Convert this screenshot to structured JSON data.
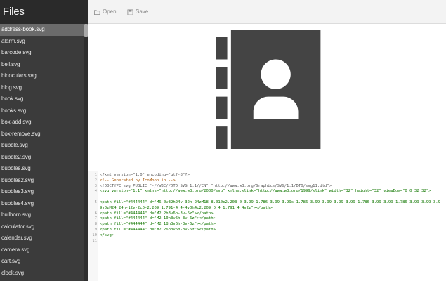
{
  "sidebar": {
    "title": "Files",
    "files": [
      "address-book.svg",
      "alarm.svg",
      "barcode.svg",
      "bell.svg",
      "binoculars.svg",
      "blog.svg",
      "book.svg",
      "books.svg",
      "box-add.svg",
      "box-remove.svg",
      "bubble.svg",
      "bubble2.svg",
      "bubbles.svg",
      "bubbles2.svg",
      "bubbles3.svg",
      "bubbles4.svg",
      "bullhorn.svg",
      "calculator.svg",
      "calendar.svg",
      "camera.svg",
      "cart.svg",
      "clock.svg"
    ],
    "active_index": 0
  },
  "toolbar": {
    "open_label": "Open",
    "save_label": "Save"
  },
  "editor": {
    "lines": [
      {
        "n": "1",
        "text": "<?xml version=\"1.0\" encoding=\"utf-8\"?>"
      },
      {
        "n": "2",
        "text": "<!-- Generated by IcoMoon.io -->"
      },
      {
        "n": "3",
        "text": "<!DOCTYPE svg PUBLIC \"-//W3C//DTD SVG 1.1//EN\" \"http://www.w3.org/Graphics/SVG/1.1/DTD/svg11.dtd\">"
      },
      {
        "n": "4",
        "text": "<svg version=\"1.1\" xmlns=\"http://www.w3.org/2000/svg\" xmlns:xlink=\"http://www.w3.org/1999/xlink\" width=\"32\" height=\"32\" viewBox=\"0 0 32 32\">"
      },
      {
        "n": "5",
        "text": "<path fill=\"#444444\" d=\"M6 0v32h24v-32h-24zM18 8.010c2.203 0 3.99 1.786 3.99 3.99s-1.786 3.99-3.99 3.99-3.99-1.786-3.99-3.99 1.786-3.99 3.99-3.99v0zM24 24h-12v-2c0-2.209 1.791-4 4-4v0h4c2.209 0 4 1.791 4 4v2z\"></path>"
      },
      {
        "n": "6",
        "text": "<path fill=\"#444444\" d=\"M2 2h3v6h-3v-6z\"></path>"
      },
      {
        "n": "7",
        "text": "<path fill=\"#444444\" d=\"M2 10h3v6h-3v-6z\"></path>"
      },
      {
        "n": "8",
        "text": "<path fill=\"#444444\" d=\"M2 18h3v6h-3v-6z\"></path>"
      },
      {
        "n": "9",
        "text": "<path fill=\"#444444\" d=\"M2 26h3v6h-3v-6z\"></path>"
      },
      {
        "n": "10",
        "text": "</svg>"
      },
      {
        "n": "11",
        "text": ""
      }
    ]
  },
  "preview": {
    "icon": "address-book-icon",
    "fill": "#444444"
  },
  "colors": {
    "sidebar_bg": "#3b3b3b",
    "sidebar_header_bg": "#2a2a2a",
    "active_item_bg": "#6b6b6b",
    "icon_fill": "#444444"
  }
}
